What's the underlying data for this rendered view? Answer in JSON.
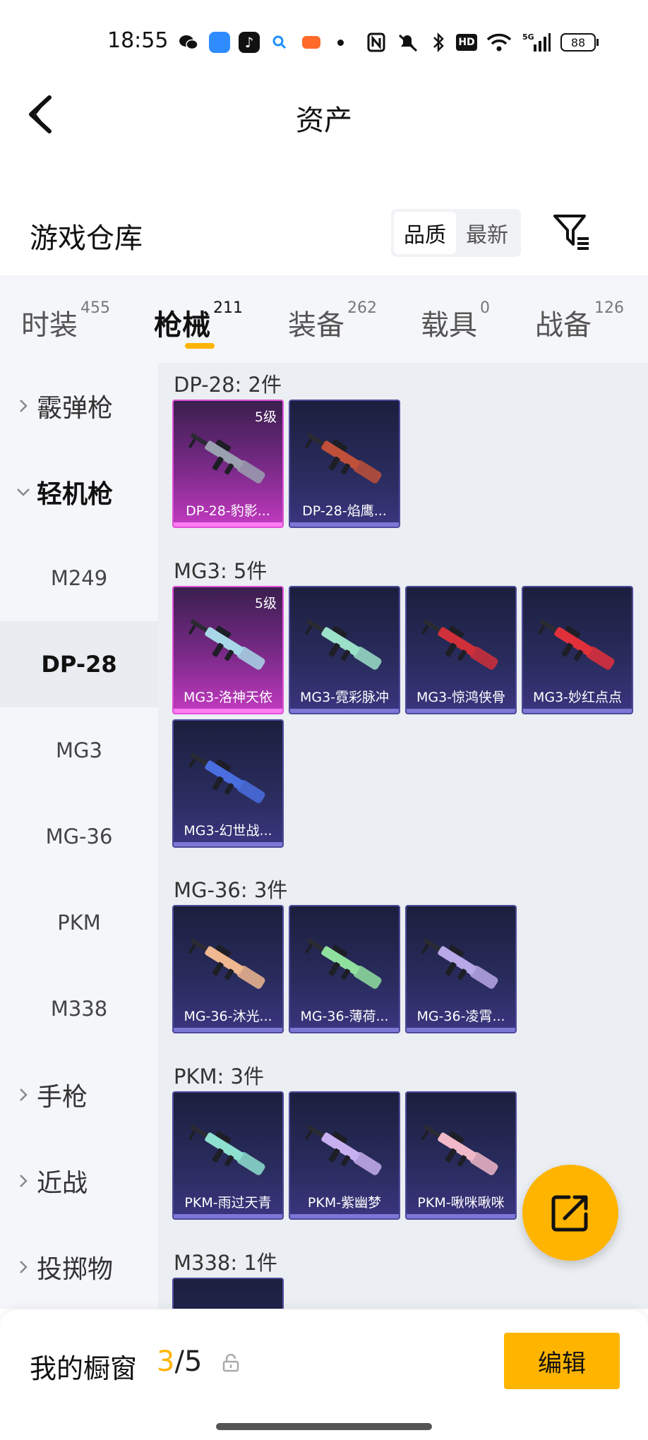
{
  "status_bar": {
    "time": "18:55",
    "battery": "88",
    "network": "5G",
    "hd": "HD"
  },
  "header": {
    "title": "资产"
  },
  "warehouse": {
    "title": "游戏仓库",
    "sort_options": [
      "品质",
      "最新"
    ],
    "active_sort": "品质"
  },
  "tabs": [
    {
      "label": "时装",
      "count": "455"
    },
    {
      "label": "枪械",
      "count": "211"
    },
    {
      "label": "装备",
      "count": "262"
    },
    {
      "label": "载具",
      "count": "0"
    },
    {
      "label": "战备",
      "count": "126"
    }
  ],
  "active_tab": "枪械",
  "sidebar": {
    "groups": [
      {
        "label": "霰弹枪",
        "expanded": false
      },
      {
        "label": "轻机枪",
        "expanded": true
      },
      {
        "label": "手枪",
        "expanded": false
      },
      {
        "label": "近战",
        "expanded": false
      },
      {
        "label": "投掷物",
        "expanded": false
      }
    ],
    "subitems": [
      "M249",
      "DP-28",
      "MG3",
      "MG-36",
      "PKM",
      "M338"
    ],
    "selected": "DP-28"
  },
  "weapon_groups": [
    {
      "label": "DP-28: 2件",
      "items": [
        {
          "name": "DP-28-豹影...",
          "tier": "5级",
          "rarity": "gold",
          "accent": "#9aa0b0"
        },
        {
          "name": "DP-28-焰鹰...",
          "tier": "",
          "rarity": "purple",
          "accent": "#c0503a"
        }
      ]
    },
    {
      "label": "MG3: 5件",
      "items": [
        {
          "name": "MG3-洛神天依",
          "tier": "5级",
          "rarity": "gold",
          "accent": "#a8d8e8"
        },
        {
          "name": "MG3-霓彩脉冲",
          "tier": "",
          "rarity": "purple",
          "accent": "#9be0c8"
        },
        {
          "name": "MG3-惊鸿侠骨",
          "tier": "",
          "rarity": "purple",
          "accent": "#d0303a"
        },
        {
          "name": "MG3-妙红点点",
          "tier": "",
          "rarity": "purple",
          "accent": "#e0303a"
        },
        {
          "name": "MG3-幻世战...",
          "tier": "",
          "rarity": "purple",
          "accent": "#4a6ee0"
        }
      ]
    },
    {
      "label": "MG-36: 3件",
      "items": [
        {
          "name": "MG-36-沐光...",
          "tier": "",
          "rarity": "purple",
          "accent": "#f0b890"
        },
        {
          "name": "MG-36-薄荷...",
          "tier": "",
          "rarity": "purple",
          "accent": "#90e0a0"
        },
        {
          "name": "MG-36-凌霄...",
          "tier": "",
          "rarity": "purple",
          "accent": "#b8a8e8"
        }
      ]
    },
    {
      "label": "PKM: 3件",
      "items": [
        {
          "name": "PKM-雨过天青",
          "tier": "",
          "rarity": "purple",
          "accent": "#8ee0d0"
        },
        {
          "name": "PKM-紫幽梦",
          "tier": "",
          "rarity": "purple",
          "accent": "#c8b0f0"
        },
        {
          "name": "PKM-啾咪啾咪",
          "tier": "",
          "rarity": "purple",
          "accent": "#f0b8c8"
        }
      ]
    },
    {
      "label": "M338: 1件",
      "items": [
        {
          "name": "",
          "tier": "",
          "rarity": "purple",
          "accent": "#9aa0b0"
        }
      ]
    }
  ],
  "showcase": {
    "label": "我的橱窗",
    "current": "3",
    "separator": "/",
    "total": "5",
    "edit_label": "编辑"
  },
  "colors": {
    "accent": "#ffb400",
    "gold_card": "#c23ac0",
    "purple_card": "#2a2c5e"
  }
}
